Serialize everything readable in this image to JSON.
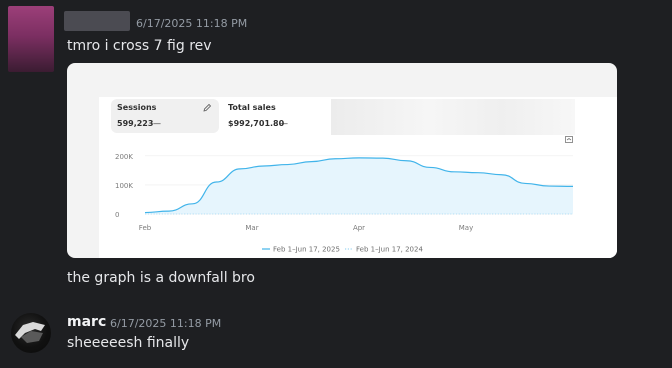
{
  "message1": {
    "timestamp": "6/17/2025 11:18 PM",
    "text": "tmro i cross 7 fig rev"
  },
  "embed": {
    "tabs": [
      {
        "label": "Sessions",
        "value": "599,223",
        "dash": "—"
      },
      {
        "label": "Total sales",
        "value": "$992,701.80",
        "dash": "—"
      }
    ],
    "chart_data": {
      "type": "area",
      "x": [
        "Feb",
        "Mar",
        "Apr",
        "May"
      ],
      "y_ticks": [
        "200K",
        "100K",
        "0"
      ],
      "ylim": [
        0,
        220000
      ],
      "series": [
        {
          "name": "Feb 1–Jun 17, 2025",
          "style": "solid",
          "color": "#41b4ea",
          "values": [
            5000,
            10000,
            35000,
            110000,
            155000,
            165000,
            170000,
            180000,
            190000,
            193000,
            192000,
            183000,
            160000,
            145000,
            142000,
            135000,
            105000,
            96000,
            95000
          ]
        },
        {
          "name": "Feb 1–Jun 17, 2024",
          "style": "dotted",
          "color": "#9fd6f2",
          "values": [
            0,
            0,
            0,
            0,
            0,
            0,
            0,
            0,
            0,
            0,
            0,
            0,
            0,
            0,
            0,
            0,
            0,
            0,
            0
          ]
        }
      ]
    }
  },
  "message2": {
    "text": "the graph is a downfall bro"
  },
  "message3": {
    "username": "marc",
    "timestamp": "6/17/2025 11:18 PM",
    "text": "sheeeeesh finally"
  }
}
